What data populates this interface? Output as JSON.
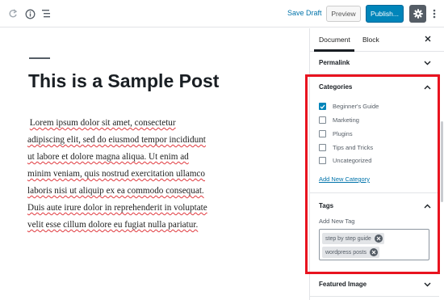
{
  "toolbar": {
    "redo_icon": "redo-icon",
    "info_icon": "info-icon",
    "outline_icon": "list-view-icon",
    "save_draft": "Save Draft",
    "preview": "Preview",
    "publish": "Publish...",
    "settings_icon": "gear-icon",
    "more_icon": "more-vertical-icon"
  },
  "editor": {
    "title": "This is a Sample Post",
    "body_lines": [
      "Lorem ipsum dolor sit amet, consectetur",
      "adipiscing elit, sed do eiusmod tempor incididunt",
      "ut labore et dolore magna aliqua. Ut enim ad",
      "minim veniam, quis nostrud exercitation ullamco",
      "laboris nisi ut aliquip ex ea commodo consequat.",
      "Duis aute irure dolor in reprehenderit in voluptate",
      "velit esse cillum dolore eu fugiat nulla pariatur."
    ]
  },
  "sidebar": {
    "tab_document": "Document",
    "tab_block": "Block",
    "permalink": "Permalink",
    "categories": {
      "title": "Categories",
      "items": [
        {
          "label": "Beginner's Guide",
          "checked": true
        },
        {
          "label": "Marketing",
          "checked": false
        },
        {
          "label": "Plugins",
          "checked": false
        },
        {
          "label": "Tips and Tricks",
          "checked": false
        },
        {
          "label": "Uncategorized",
          "checked": false
        }
      ],
      "add_new": "Add New Category"
    },
    "tags": {
      "title": "Tags",
      "add_new_label": "Add New Tag",
      "items": [
        "step by step guide",
        "wordpress posts"
      ]
    },
    "featured_image": "Featured Image"
  },
  "colors": {
    "accent": "#0085ba",
    "link": "#0073aa",
    "highlight": "#e8131f"
  }
}
